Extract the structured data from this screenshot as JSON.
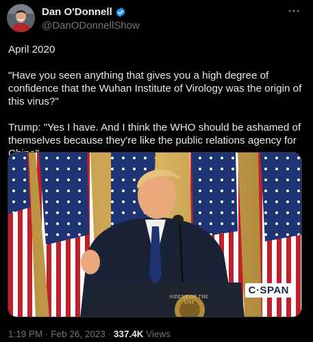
{
  "author": {
    "name": "Dan O'Donnell",
    "handle": "@DanODonnellShow"
  },
  "tweet": {
    "paragraphs": [
      "April 2020",
      "\"Have you seen anything that gives you a high degree of confidence that the Wuhan Institute of Virology was the origin of this virus?\"",
      "Trump: \"Yes I have. And I think the WHO should be ashamed of themselves because they're like the public relations agency for China\""
    ]
  },
  "media": {
    "watermark": "C·SPAN",
    "podium_seal_text": "SIDENT OF THE UNI"
  },
  "meta": {
    "time": "1:19 PM",
    "separator": "·",
    "date": "Feb 26, 2023",
    "views_count": "337.4K",
    "views_label": "Views"
  },
  "colors": {
    "background": "#000000",
    "text": "#e7e9ea",
    "secondary": "#71767b",
    "verified": "#1d9bf0"
  }
}
